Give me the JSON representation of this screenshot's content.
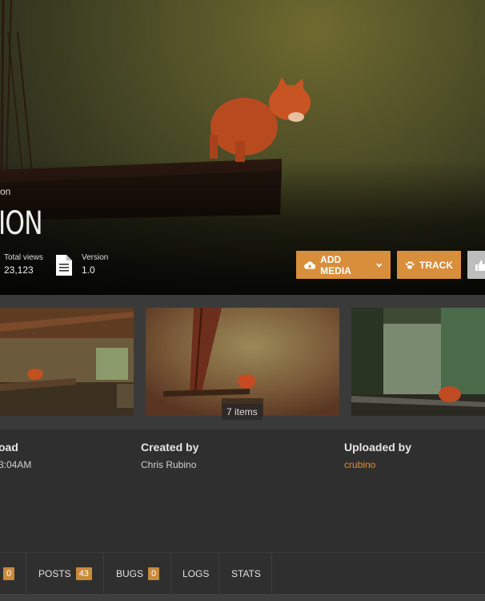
{
  "hero": {
    "category_partial": "on",
    "title_partial": "ION",
    "stats": [
      {
        "label": "Total views",
        "value": "23,123"
      },
      {
        "label": "Version",
        "value": "1.0"
      }
    ],
    "buttons": {
      "add_media": "ADD MEDIA",
      "track": "TRACK"
    }
  },
  "gallery": {
    "items_count": "7 items"
  },
  "info": {
    "upload": {
      "heading": "oad",
      "value": "3:04AM"
    },
    "created": {
      "heading": "Created by",
      "value": "Chris Rubino"
    },
    "uploaded": {
      "heading": "Uploaded by",
      "value": "crubino"
    }
  },
  "tabs": [
    {
      "label": "",
      "count": "0"
    },
    {
      "label": "POSTS",
      "count": "43"
    },
    {
      "label": "BUGS",
      "count": "0"
    },
    {
      "label": "LOGS",
      "count": ""
    },
    {
      "label": "STATS",
      "count": ""
    }
  ],
  "colors": {
    "accent": "#d98e3b",
    "background": "#2b2b2b"
  }
}
